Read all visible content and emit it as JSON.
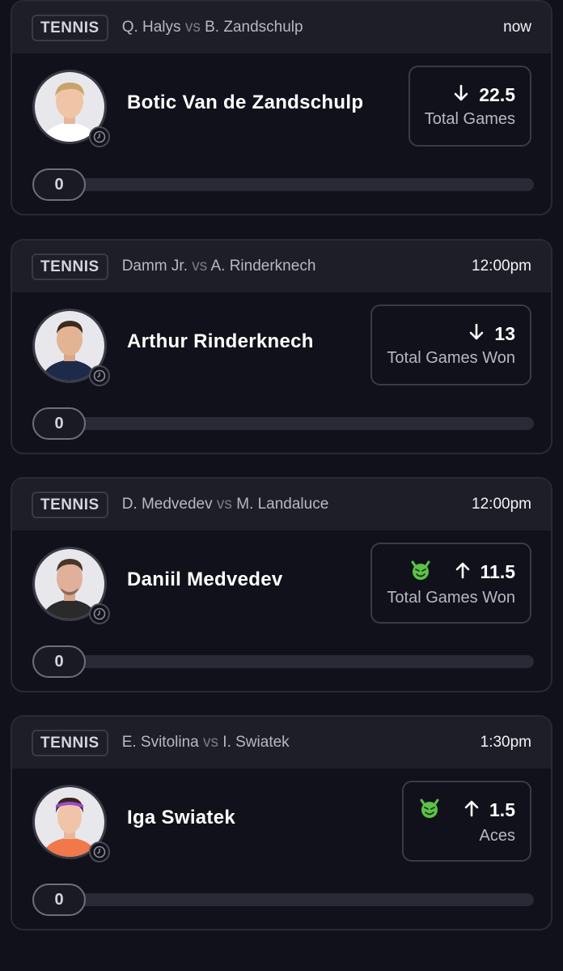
{
  "cards": [
    {
      "sport": "TENNIS",
      "p1": "Q. Halys",
      "vs": "vs",
      "p2": "B. Zandschulp",
      "time": "now",
      "player": "Botic Van de Zandschulp",
      "direction": "down",
      "arrow": "↓",
      "value": "22.5",
      "stat": "Total Games",
      "devil": false,
      "count": "0",
      "progress": 0
    },
    {
      "sport": "TENNIS",
      "p1": "Damm Jr.",
      "vs": "vs",
      "p2": "A. Rinderknech",
      "time": "12:00pm",
      "player": "Arthur Rinderknech",
      "direction": "down",
      "arrow": "↓",
      "value": "13",
      "stat": "Total Games Won",
      "devil": false,
      "count": "0",
      "progress": 0
    },
    {
      "sport": "TENNIS",
      "p1": "D. Medvedev",
      "vs": "vs",
      "p2": "M. Landaluce",
      "time": "12:00pm",
      "player": "Daniil Medvedev",
      "direction": "up",
      "arrow": "↑",
      "value": "11.5",
      "stat": "Total Games Won",
      "devil": true,
      "count": "0",
      "progress": 0
    },
    {
      "sport": "TENNIS",
      "p1": "E. Svitolina",
      "vs": "vs",
      "p2": "I. Swiatek",
      "time": "1:30pm",
      "player": "Iga Swiatek",
      "direction": "up",
      "arrow": "↑",
      "value": "1.5",
      "stat": "Aces",
      "devil": true,
      "count": "0",
      "progress": 0
    }
  ],
  "colors": {
    "background": "#11111b",
    "card_header": "#1e1e29",
    "border": "#3a3a48",
    "devil_green": "#5cc24a"
  },
  "icons": {
    "clock": "clock-icon",
    "devil": "devil-emoji-icon",
    "arrow_up": "arrow-up-icon",
    "arrow_down": "arrow-down-icon"
  }
}
